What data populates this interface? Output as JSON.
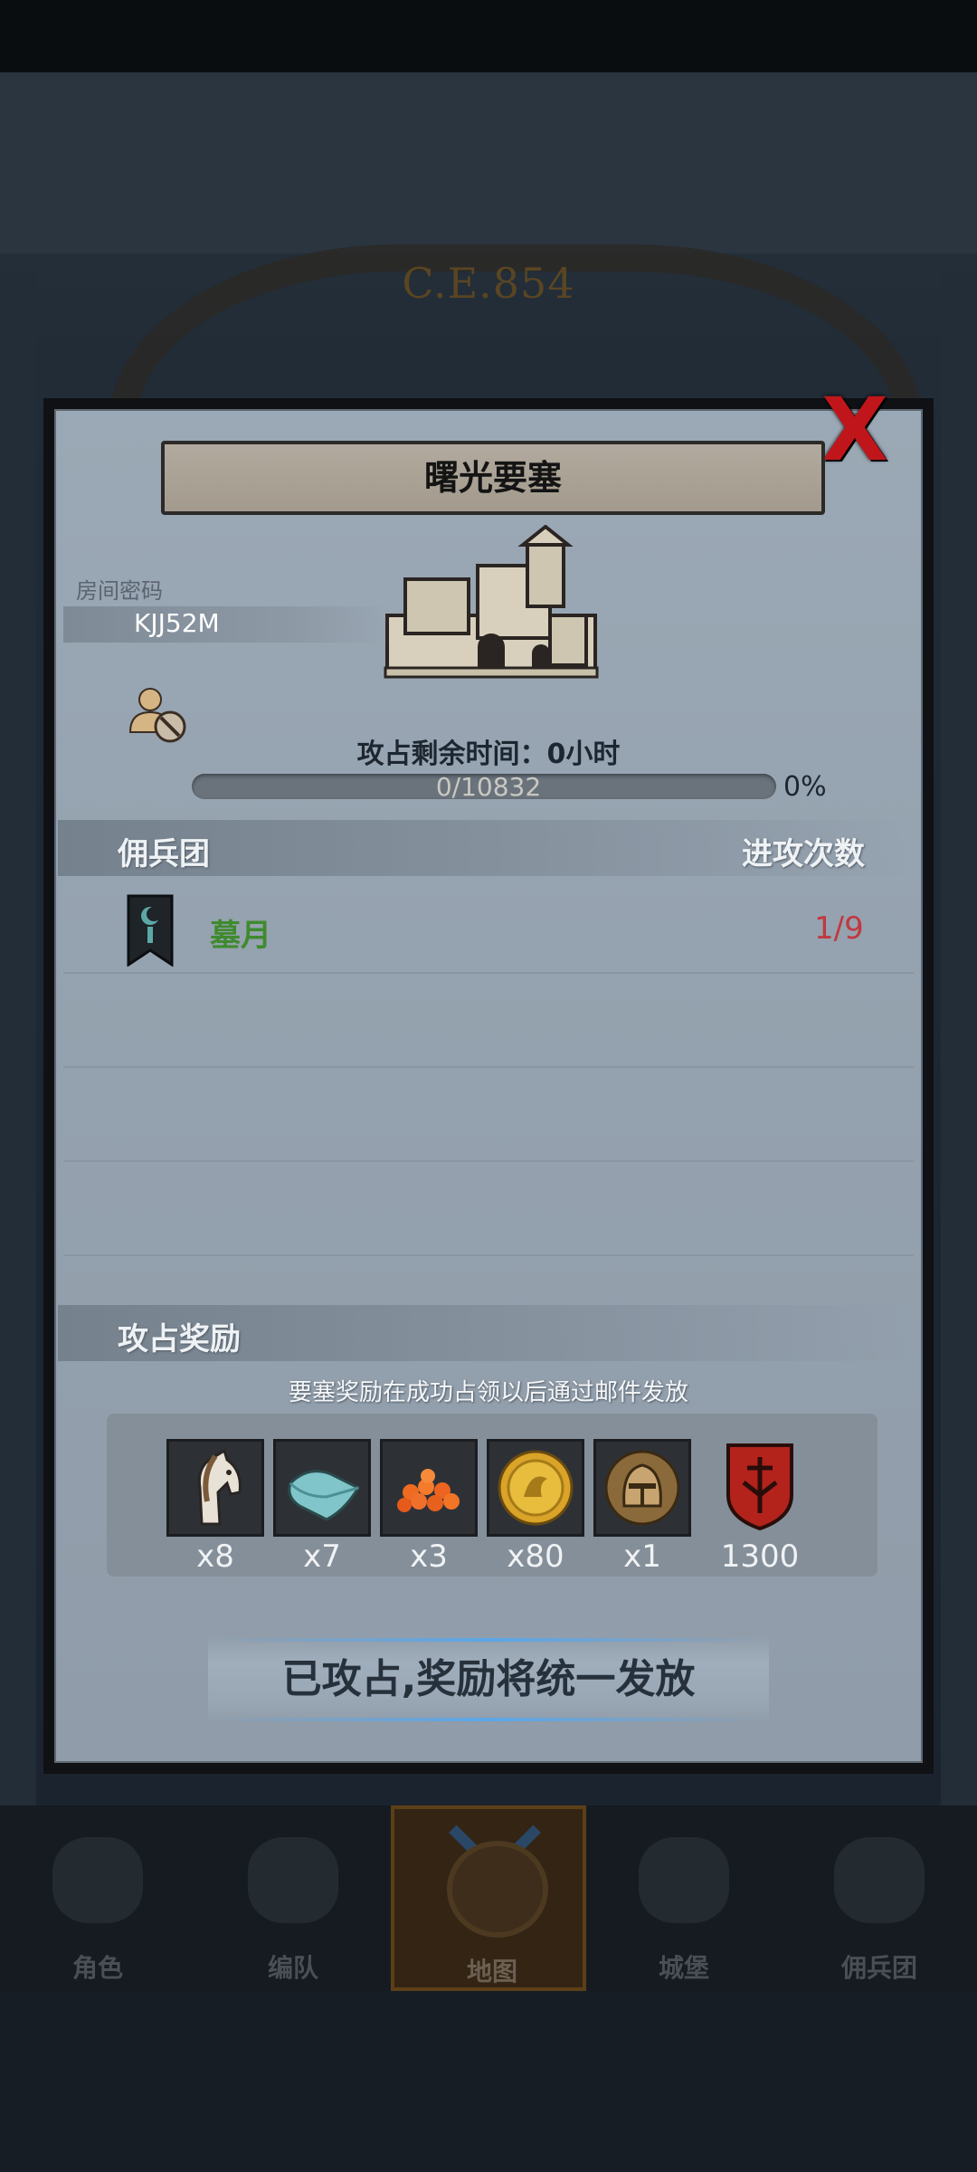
{
  "background": {
    "era_label": "C.E.854"
  },
  "dialog": {
    "title": "曙光要塞",
    "close_label": "X",
    "room_password": {
      "label": "房间密码",
      "value": "KJJ52M"
    },
    "remaining_time_text": "攻占剩余时间：0小时",
    "progress": {
      "text": "0/10832",
      "percent_text": "0%",
      "fraction": 0
    },
    "mercenary_section": {
      "title": "佣兵团",
      "attacks_header": "进攻次数",
      "rows": [
        {
          "name": "墓月",
          "attacks": "1/9"
        }
      ]
    },
    "reward_section": {
      "title": "攻占奖励",
      "note": "要塞奖励在成功占领以后通过邮件发放",
      "items": [
        {
          "icon": "horse-icon",
          "qty": "x8"
        },
        {
          "icon": "cloth-icon",
          "qty": "x7"
        },
        {
          "icon": "berries-icon",
          "qty": "x3"
        },
        {
          "icon": "gold-coin-icon",
          "qty": "x80"
        },
        {
          "icon": "helmet-icon",
          "qty": "x1"
        },
        {
          "icon": "shield-emblem-icon",
          "qty": "1300"
        }
      ]
    },
    "captured_button": "已攻占,奖励将统一发放"
  },
  "nav": {
    "items": [
      {
        "label": "角色"
      },
      {
        "label": "编队"
      },
      {
        "label": "地图",
        "active": true
      },
      {
        "label": "城堡"
      },
      {
        "label": "佣兵团"
      }
    ]
  },
  "colors": {
    "accent_red": "#c0161b",
    "merc_green": "#3f8a2e",
    "attack_red": "#c0393f",
    "gold": "#c6a046"
  }
}
